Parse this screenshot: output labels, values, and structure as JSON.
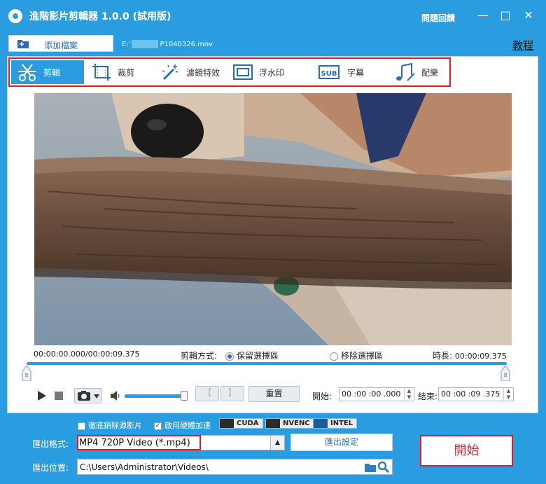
{
  "app": {
    "title": "進階影片剪輯器 1.0.0 (試用版)",
    "feedback": "問題回饋"
  },
  "toolbar": {
    "add_file": "添加檔案",
    "file_path_prefix": "E:'",
    "file_path_suffix": "P1040326.mov",
    "tutorial": "教程"
  },
  "tabs": [
    {
      "label": "剪輯",
      "icon": "scissors-icon",
      "active": true
    },
    {
      "label": "裁剪",
      "icon": "crop-icon",
      "active": false
    },
    {
      "label": "濾鏡特效",
      "icon": "magic-wand-icon",
      "active": false
    },
    {
      "label": "浮水印",
      "icon": "watermark-icon",
      "active": false
    },
    {
      "label": "字幕",
      "icon": "subtitle-icon",
      "active": false
    },
    {
      "label": "配樂",
      "icon": "music-icon",
      "active": false
    }
  ],
  "timeline": {
    "current_time": "00:00:00.000",
    "total_time": "00:00:09.375",
    "time_separator": "/",
    "cut_mode_label": "剪輯方式:",
    "keep_option": "保留選擇區",
    "remove_option": "移除選擇區",
    "selected_mode": "keep",
    "duration_label": "時長:",
    "duration_value": "00:00:09.375"
  },
  "controls": {
    "reset": "重置",
    "start_label": "開始:",
    "start_value": "00 :00 :00 .000",
    "end_label": "結束:",
    "end_value": "00 :00 :09 .375",
    "volume_level": 1.0
  },
  "bottom": {
    "erase_audio": "徹底銷除源影片",
    "erase_audio_checked": false,
    "hw_accel": "啟用硬體加速",
    "hw_accel_checked": true,
    "gpu_options": [
      "CUDA",
      "NVENC",
      "INTEL"
    ],
    "format_label": "匯出格式:",
    "format_value": "MP4 720P Video (*.mp4)",
    "export_settings": "匯出設定",
    "location_label": "匯出位置:",
    "location_value": "C:\\Users\\Administrator\\Videos\\",
    "start_button": "開始"
  },
  "colors": {
    "accent": "#2a9de0",
    "highlight_frame": "#d61f2c"
  }
}
